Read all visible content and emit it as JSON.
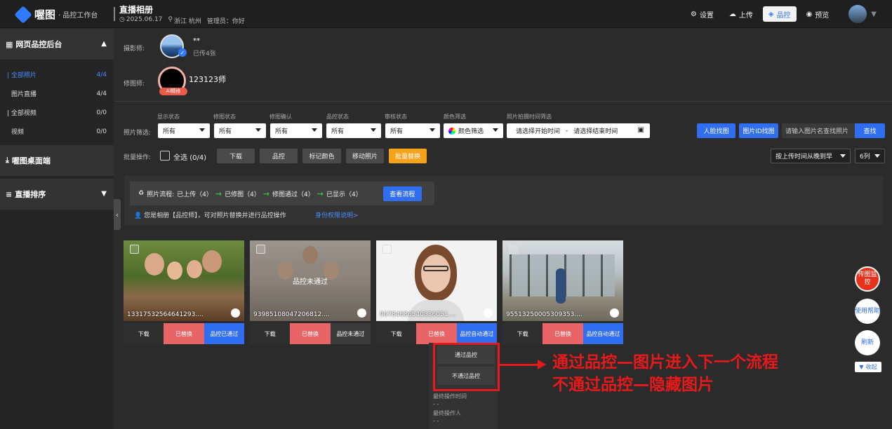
{
  "topbar": {
    "logo_name": "喔图",
    "logo_sub": "· 品控工作台",
    "album_title": "直播相册",
    "album_date": "2025.06.17",
    "album_location": "浙江 杭州",
    "album_admin": "管理员：你好",
    "buttons": [
      {
        "label": "设置",
        "icon": "gear-icon"
      },
      {
        "label": "上传",
        "icon": "cloud-upload-icon"
      },
      {
        "label": "品控",
        "icon": "cube-icon",
        "active": true
      },
      {
        "label": "预览",
        "icon": "eye-icon"
      }
    ]
  },
  "sidebar": {
    "group1": "网页品控后台",
    "items": [
      {
        "label": "全部照片",
        "count": "4/4",
        "selected": true
      },
      {
        "label": "图片直播",
        "count": "4/4"
      },
      {
        "label": "全部视频",
        "count": "0/0"
      },
      {
        "label": "视频",
        "count": "0/0"
      }
    ],
    "group2": "喔图桌面端",
    "group3": "直播排序"
  },
  "people": {
    "photographer_label": "摄影师:",
    "photographer_name": "**",
    "photographer_sub": "已传4张",
    "retoucher_label": "修图师:",
    "retoucher_name": "123123师",
    "ai_tag": "AI精修"
  },
  "filters": {
    "row_label": "照片筛选:",
    "groups": [
      {
        "head": "显示状态",
        "value": "所有"
      },
      {
        "head": "修图状态",
        "value": "所有"
      },
      {
        "head": "修图确认",
        "value": "所有"
      },
      {
        "head": "品控状态",
        "value": "所有"
      },
      {
        "head": "审核状态",
        "value": "所有"
      }
    ],
    "color_head": "颜色筛选",
    "color_value": "颜色筛选",
    "time_head": "照片拍摄时间筛选",
    "time_start": "请选择开始时间",
    "time_sep": "-",
    "time_end": "请选择结束时间",
    "face_btn": "人脸找图",
    "id_btn": "图片ID找图",
    "search_placeholder": "请输入图片名查找照片",
    "search_btn": "查找"
  },
  "batch": {
    "label": "批量操作:",
    "select_all": "全选",
    "select_count": "(0/4)",
    "download": "下载",
    "qc": "品控",
    "mark_color": "标记颜色",
    "move": "移动照片",
    "batch_replace": "批量替换",
    "sort": "按上传时间从晚到早",
    "cols": "6列"
  },
  "flow": {
    "prefix": "照片流程:",
    "steps": [
      "已上传（4）",
      "已修图（4）",
      "修图通过（4）",
      "已显示（4）"
    ],
    "view_btn": "查看流程",
    "note": "您是相册【品控师】，可对照片替换并进行品控操作",
    "link": "身份权限说明>"
  },
  "photos": [
    {
      "id": "13317532564641293....",
      "overlay": "",
      "a1": "下载",
      "a2": "已替换",
      "a3": "品控已通过"
    },
    {
      "id": "93985108047206812....",
      "overlay": "品控未通过",
      "a1": "下载",
      "a2": "已替换",
      "a3": "品控未通过"
    },
    {
      "id": "90784686540836051....",
      "overlay": "",
      "a1": "下载",
      "a2": "已替换",
      "a3": "品控自动通过"
    },
    {
      "id": "95513250005309353....",
      "overlay": "",
      "a1": "下载",
      "a2": "已替换",
      "a3": "品控自动通过"
    }
  ],
  "qc_menu": {
    "pass": "通过品控",
    "fail": "不通过品控",
    "last_time_label": "最终操作时间",
    "last_time_value": "- -",
    "last_user_label": "最终操作人",
    "last_user_value": "- -"
  },
  "annotation": {
    "line1": "通过品控—图片进入下一个流程",
    "line2": "不通过品控—隐藏图片"
  },
  "float": {
    "monitor": "传图监控",
    "help": "使用帮助",
    "refresh": "刷新",
    "collapse": "收起"
  },
  "colors": {
    "accent": "#2f6ef0",
    "replace": "#e86466",
    "warning": "#f7a21b",
    "annotation": "#e8191b"
  }
}
